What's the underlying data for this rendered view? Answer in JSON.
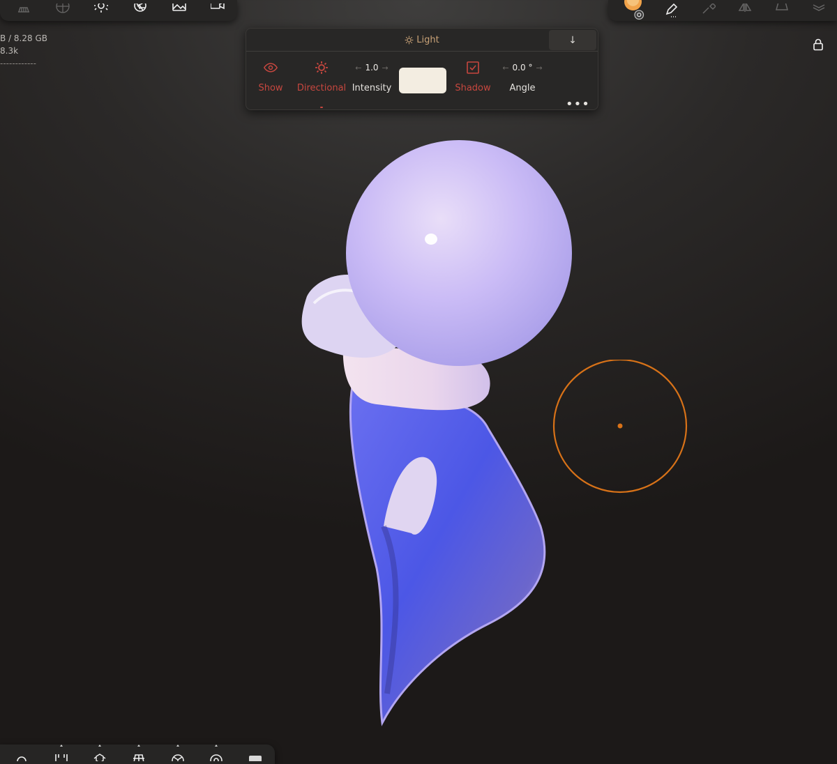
{
  "stats": {
    "memory": "B / 8.28 GB",
    "polycount": "8.3k",
    "separator": "------------"
  },
  "light_panel": {
    "title": "Light",
    "collapse_icon": "arrow-down-icon",
    "show_label": "Show",
    "directional_label": "Directional",
    "intensity_value": "1.0",
    "intensity_label": "Intensity",
    "light_color": "#f3ede1",
    "shadow_label": "Shadow",
    "shadow_checked": true,
    "angle_value": "0.0 °",
    "angle_label": "Angle",
    "more_label": "•••",
    "accent_color": "#c7473f"
  },
  "top_left_toolbar": [
    "grid-icon",
    "sphere-icon",
    "sun-icon",
    "aperture-icon",
    "image-icon",
    "camera-icon"
  ],
  "top_right_toolbar": [
    "material-ball-icon",
    "pen-icon",
    "tool-icon",
    "symmetry-icon",
    "shape-icon",
    "layers-icon"
  ],
  "bottom_toolbar": [
    "search-icon",
    "mask-icon",
    "cubes-icon",
    "frame-icon",
    "mesh-icon",
    "eye-icon",
    "shade-icon"
  ],
  "brush": {
    "color": "#d87218"
  },
  "sculpt": {
    "colors": [
      "#c9b8f5",
      "#5c63ec",
      "#eddff1"
    ]
  }
}
